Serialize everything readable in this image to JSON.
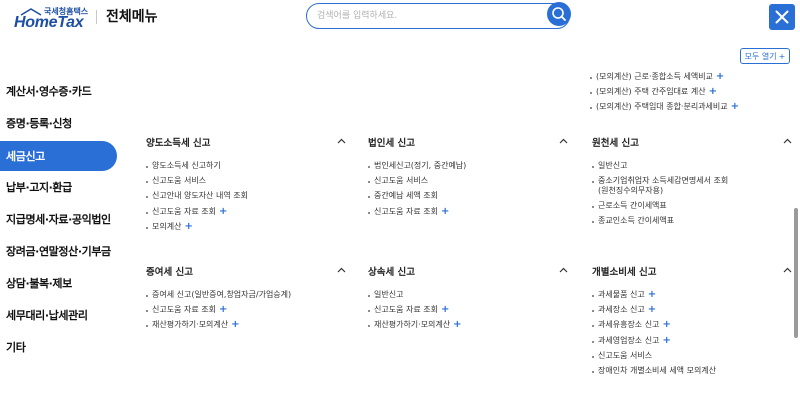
{
  "header": {
    "logo_small": "국세청홈택스",
    "logo_main": "HomeTax",
    "title": "전체메뉴",
    "search_placeholder": "검색어를 입력하세요.",
    "expand_all_label": "모두 열기",
    "expand_all_plus": "+"
  },
  "colors": {
    "accent": "#2a6fd6",
    "text": "#222222"
  },
  "sidebar": {
    "items": [
      {
        "label": "계산서·영수증·카드",
        "active": false
      },
      {
        "label": "증명·등록·신청",
        "active": false
      },
      {
        "label": "세금신고",
        "active": true
      },
      {
        "label": "납부·고지·환급",
        "active": false
      },
      {
        "label": "지급명세·자료·공익법인",
        "active": false
      },
      {
        "label": "장려금·연말정산·기부금",
        "active": false
      },
      {
        "label": "상담·불복·제보",
        "active": false
      },
      {
        "label": "세무대리·납세관리",
        "active": false
      },
      {
        "label": "기타",
        "active": false
      }
    ]
  },
  "top_items": [
    {
      "label": "(모의계산) 근로·종합소득 세액비교",
      "plus": "+"
    },
    {
      "label": "(모의계산) 주택 간주임대료 계산",
      "plus": "+"
    },
    {
      "label": "(모의계산) 주택임대 종합·분리과세비교",
      "plus": "+"
    }
  ],
  "sections": [
    {
      "title": "양도소득세 신고",
      "items": [
        {
          "label": "양도소득세 신고하기",
          "plus": ""
        },
        {
          "label": "신고도움 서비스",
          "plus": ""
        },
        {
          "label": "신고안내 양도자산 내역 조회",
          "plus": ""
        },
        {
          "label": "신고도움 자료 조회",
          "plus": "+"
        },
        {
          "label": "모의계산",
          "plus": "+"
        }
      ]
    },
    {
      "title": "법인세 신고",
      "items": [
        {
          "label": "법인세신고(정기, 중간예납)",
          "plus": ""
        },
        {
          "label": "신고도움 서비스",
          "plus": ""
        },
        {
          "label": "중간예납 세액 조회",
          "plus": ""
        },
        {
          "label": "신고도움 자료 조회",
          "plus": "+"
        }
      ]
    },
    {
      "title": "원천세 신고",
      "items": [
        {
          "label": "일반신고",
          "plus": ""
        },
        {
          "label": "중소기업취업자 소득세감면명세서 조회",
          "sub": "(원천징수의무자용)",
          "plus": ""
        },
        {
          "label": "근로소득 간이세액표",
          "plus": ""
        },
        {
          "label": "종교인소득 간이세액표",
          "plus": ""
        }
      ]
    },
    {
      "title": "증여세 신고",
      "items": [
        {
          "label": "증여세 신고(일반증여,창업자금/가업승계)",
          "plus": ""
        },
        {
          "label": "신고도움 자료 조회",
          "plus": "+"
        },
        {
          "label": "재산평가하기·모의계산",
          "plus": "+"
        }
      ]
    },
    {
      "title": "상속세 신고",
      "items": [
        {
          "label": "일반신고",
          "plus": ""
        },
        {
          "label": "신고도움 자료 조회",
          "plus": "+"
        },
        {
          "label": "재산평가하기·모의계산",
          "plus": "+"
        }
      ]
    },
    {
      "title": "개별소비세 신고",
      "items": [
        {
          "label": "과세물품 신고",
          "plus": "+"
        },
        {
          "label": "과세장소 신고",
          "plus": "+"
        },
        {
          "label": "과세유흥장소 신고",
          "plus": "+"
        },
        {
          "label": "과세영업장소 신고",
          "plus": "+"
        },
        {
          "label": "신고도움 서비스",
          "plus": ""
        },
        {
          "label": "장애인차 개별소비세 세액 모의계산",
          "plus": ""
        }
      ]
    }
  ]
}
